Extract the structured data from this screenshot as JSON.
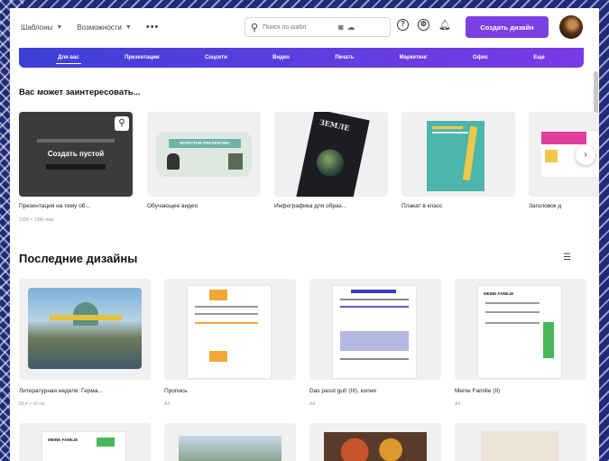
{
  "topbar": {
    "menu": [
      {
        "label": "Шаблоны"
      },
      {
        "label": "Возможности"
      }
    ],
    "more": "•••",
    "search_placeholder": "Поиск по шабл",
    "create_label": "Создать дизайн"
  },
  "categories": [
    "Для вас",
    "Презентации",
    "Соцсети",
    "Видео",
    "Печать",
    "Маркетинг",
    "Офис",
    "Еще"
  ],
  "recommend": {
    "title": "Вас может заинтересовать...",
    "cards": [
      {
        "label": "Презентация на тему об...",
        "sub": "1920 × 1080 пикс",
        "overlay": "Создать пустой"
      },
      {
        "label": "Обучающее видео",
        "sub": "",
        "overlay": "EFFECTIVE PRESENTING"
      },
      {
        "label": "Инфографика для образ...",
        "sub": "",
        "overlay": "ЗЕМЛЕ"
      },
      {
        "label": "Плакат в класс",
        "sub": "",
        "overlay": ""
      },
      {
        "label": "Заголовок д",
        "sub": "",
        "overlay": ""
      }
    ]
  },
  "recent": {
    "title": "Последние дизайны",
    "cards": [
      {
        "label": "Литературная неделя: Герма...",
        "sub": "59,4 × 42 см"
      },
      {
        "label": "Пропись",
        "sub": "A4"
      },
      {
        "label": "Das passt gut! (III), копия",
        "sub": "A4"
      },
      {
        "label": "Meine Familie (II)",
        "sub": "A4"
      }
    ],
    "second_row_heading": "MEINE FAMILIE"
  },
  "colors": {
    "accent": "#7b3fe4",
    "catbar_start": "#3d3fd8",
    "catbar_end": "#7b3ae5"
  }
}
